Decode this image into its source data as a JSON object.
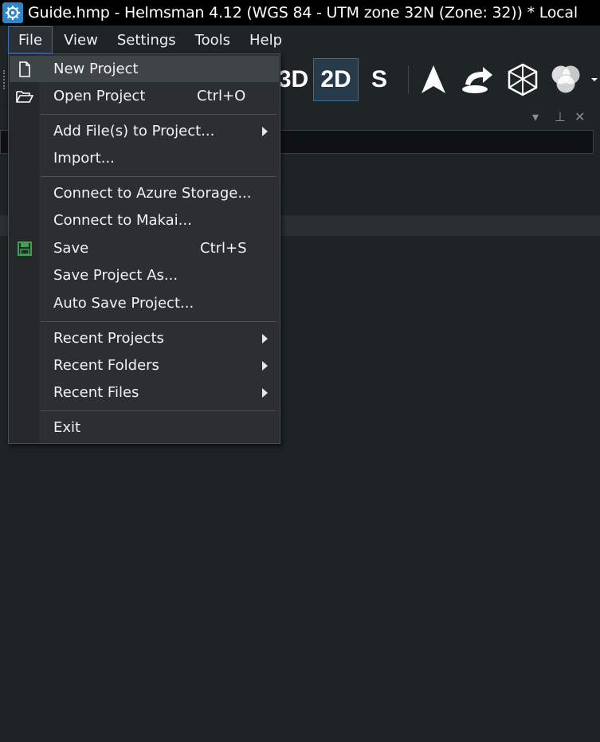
{
  "window": {
    "title": "Guide.hmp - Helmsman 4.12 (WGS 84 - UTM zone 32N (Zone: 32)) * Local",
    "app_icon": "helmsman-app-icon"
  },
  "menubar": {
    "items": [
      {
        "label": "File"
      },
      {
        "label": "View"
      },
      {
        "label": "Settings"
      },
      {
        "label": "Tools"
      },
      {
        "label": "Help"
      }
    ]
  },
  "toolbar": {
    "view_3d": "3D",
    "view_2d": "2D",
    "view_s": "S",
    "icons": [
      "navigation-arrow-icon",
      "import-layer-icon",
      "wireframe-cube-icon",
      "color-circles-icon",
      "overflow-chevron-icon"
    ]
  },
  "file_menu": {
    "items": [
      {
        "label": "New Project",
        "shortcut": "",
        "icon": "new-document-icon",
        "submenu": false
      },
      {
        "label": "Open Project",
        "shortcut": "Ctrl+O",
        "icon": "open-folder-icon",
        "submenu": false
      },
      {
        "label": "Add File(s) to Project...",
        "shortcut": "",
        "icon": "",
        "submenu": true
      },
      {
        "label": "Import...",
        "shortcut": "",
        "icon": "",
        "submenu": false
      },
      {
        "label": "Connect to Azure Storage...",
        "shortcut": "",
        "icon": "",
        "submenu": false
      },
      {
        "label": "Connect to Makai...",
        "shortcut": "",
        "icon": "",
        "submenu": false
      },
      {
        "label": "Save",
        "shortcut": "Ctrl+S",
        "icon": "save-disk-icon",
        "submenu": false
      },
      {
        "label": "Save Project As...",
        "shortcut": "",
        "icon": "",
        "submenu": false
      },
      {
        "label": "Auto Save Project...",
        "shortcut": "",
        "icon": "",
        "submenu": false
      },
      {
        "label": "Recent Projects",
        "shortcut": "",
        "icon": "",
        "submenu": true
      },
      {
        "label": "Recent Folders",
        "shortcut": "",
        "icon": "",
        "submenu": true
      },
      {
        "label": "Recent Files",
        "shortcut": "",
        "icon": "",
        "submenu": true
      },
      {
        "label": "Exit",
        "shortcut": "",
        "icon": "",
        "submenu": false
      }
    ]
  },
  "colors": {
    "accent": "#3a6fb5",
    "save_icon": "#3fa34d",
    "app_icon": "#2f86c9"
  }
}
